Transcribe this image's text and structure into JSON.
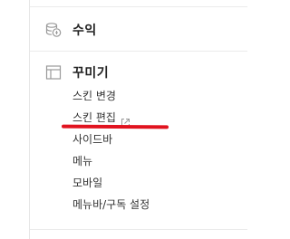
{
  "revenue": {
    "label": "수익",
    "icon": "coins-icon"
  },
  "decorate": {
    "label": "꾸미기",
    "icon": "layout-icon",
    "items": [
      {
        "label": "스킨 변경"
      },
      {
        "label": "스킨 편집",
        "icon": "external-link-icon"
      },
      {
        "label": "사이드바"
      },
      {
        "label": "메뉴"
      },
      {
        "label": "모바일"
      },
      {
        "label": "메뉴바/구독 설정"
      }
    ]
  },
  "colors": {
    "annotation_underline": "#e1131f",
    "icon_gray": "#9a9a9a",
    "text": "#333333"
  }
}
